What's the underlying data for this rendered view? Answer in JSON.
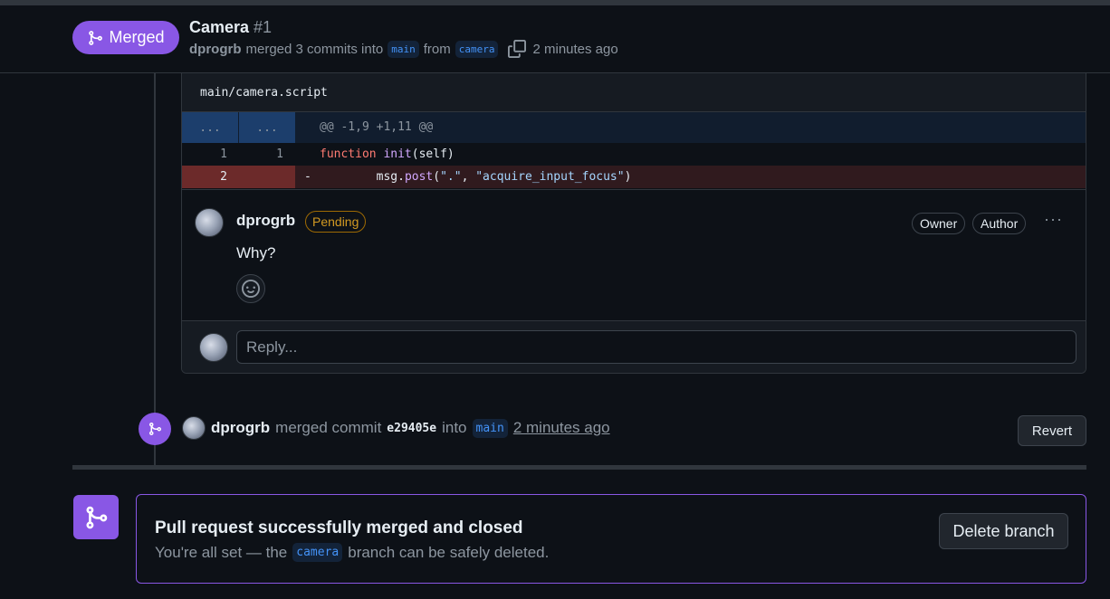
{
  "header": {
    "status_label": "Merged",
    "title": "Camera",
    "number": "#1",
    "author": "dprogrb",
    "merged_text": "merged 3 commits into",
    "base_branch": "main",
    "from_text": "from",
    "head_branch": "camera",
    "time": "2 minutes ago"
  },
  "diff": {
    "file_path": "main/camera.script",
    "hunk_left": "...",
    "hunk_right": "...",
    "hunk_header": "@@ -1,9 +1,11 @@",
    "lines": [
      {
        "old": "1",
        "new": "1",
        "keyword": "function",
        "func": "init",
        "rest": "(self)"
      },
      {
        "old": "2",
        "new": "",
        "marker": "-",
        "indent": "        ",
        "obj": "msg.",
        "method": "post",
        "open": "(",
        "arg1": "\".\"",
        "sep": ", ",
        "arg2": "\"acquire_input_focus\"",
        "close": ")"
      }
    ]
  },
  "comment": {
    "author": "dprogrb",
    "status": "Pending",
    "role_owner": "Owner",
    "role_author": "Author",
    "menu": "···",
    "body": "Why?"
  },
  "reply": {
    "placeholder": "Reply..."
  },
  "merge_event": {
    "author": "dprogrb",
    "action": "merged commit",
    "sha": "e29405e",
    "into": "into",
    "branch": "main",
    "time": "2 minutes ago",
    "revert_label": "Revert"
  },
  "final": {
    "title": "Pull request successfully merged and closed",
    "subtitle_pre": "You're all set — the",
    "branch": "camera",
    "subtitle_post": "branch can be safely deleted.",
    "delete_label": "Delete branch"
  },
  "colors": {
    "merged_purple": "#8957e5",
    "background": "#0d1117",
    "border": "#30363d",
    "pending": "#d29922"
  },
  "icons": [
    "git-merge-icon",
    "copy-icon",
    "smiley-icon",
    "kebab-menu-icon",
    "avatar"
  ]
}
